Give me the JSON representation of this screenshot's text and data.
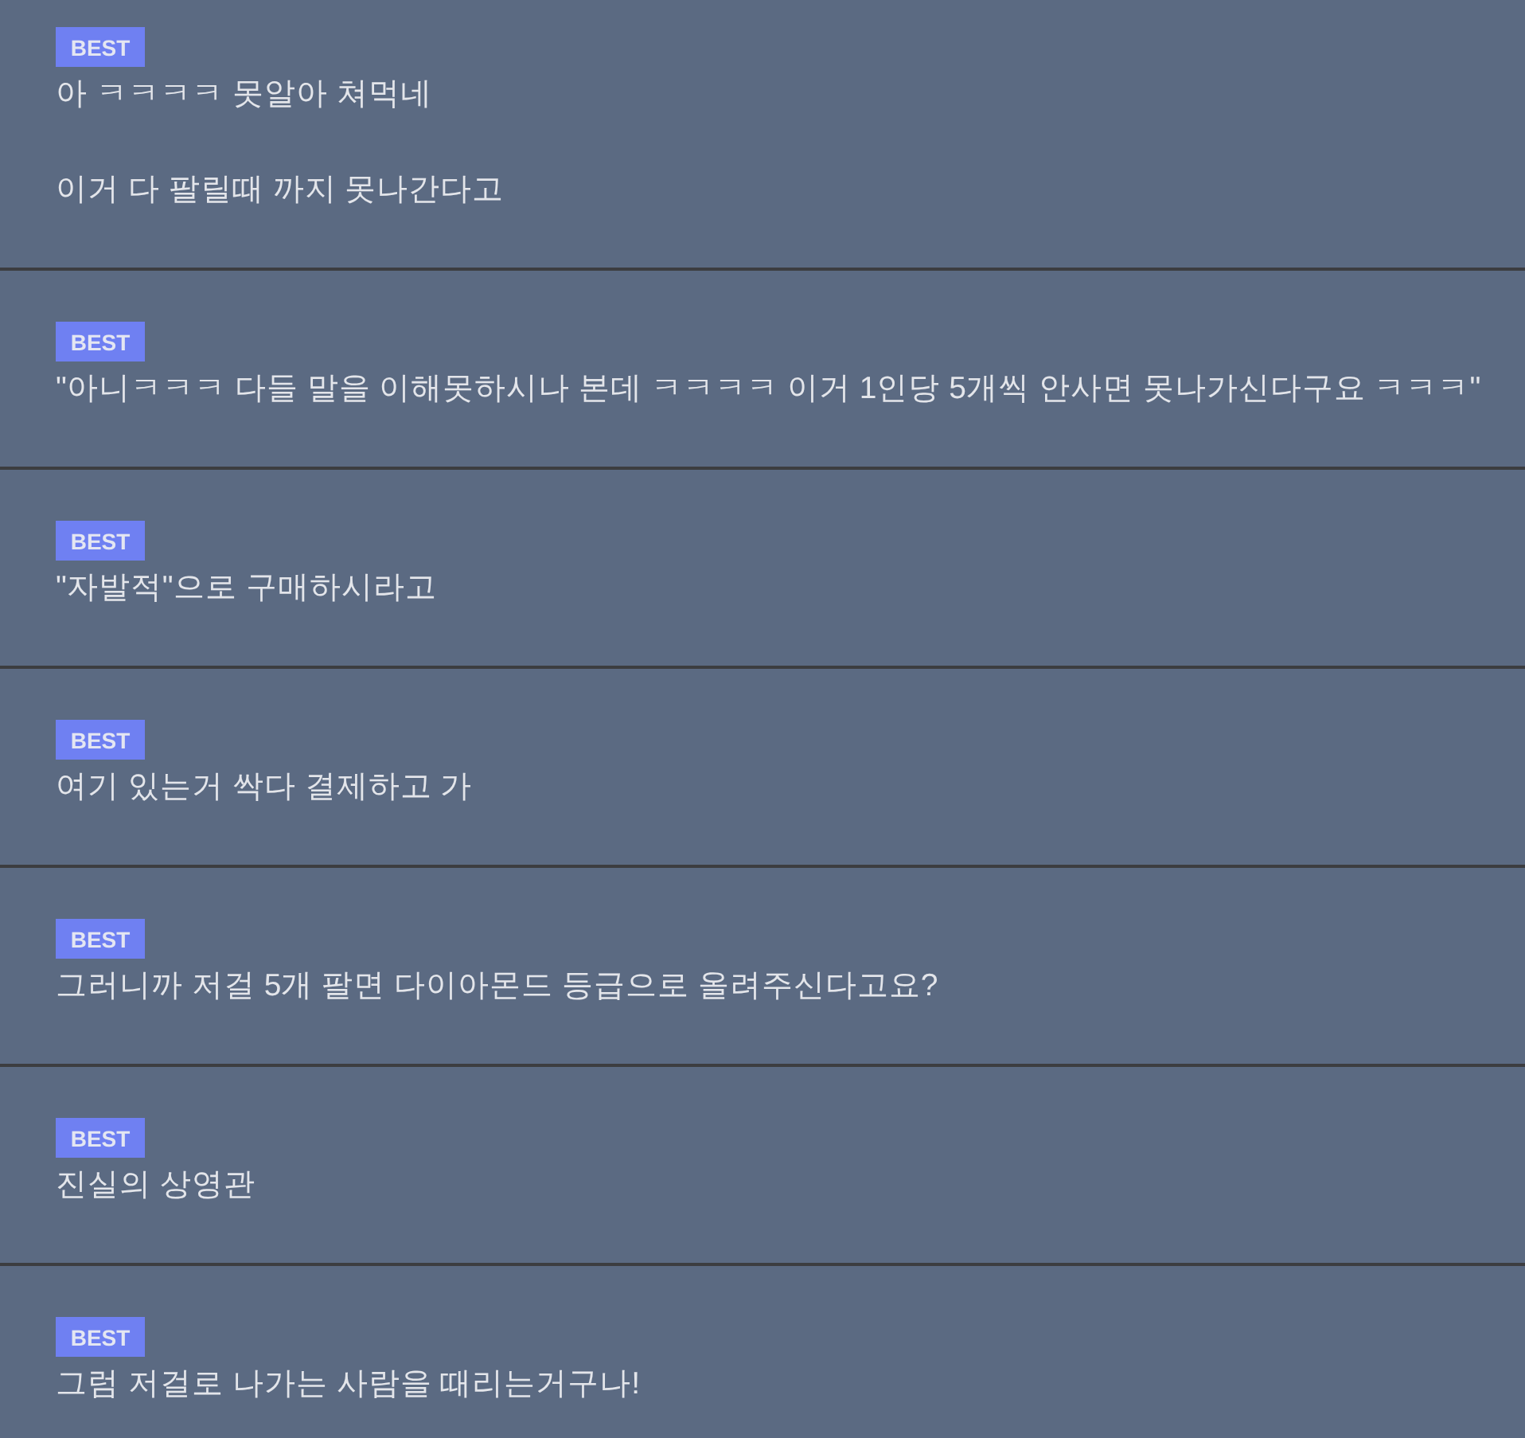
{
  "comments": [
    {
      "badge": "BEST",
      "text": "아 ㅋㅋㅋㅋ 못알아 쳐먹네\n\n이거 다 팔릴때 까지 못나간다고"
    },
    {
      "badge": "BEST",
      "text": "\"아니ㅋㅋㅋ 다들 말을 이해못하시나 본데 ㅋㅋㅋㅋ 이거 1인당 5개씩 안사면 못나가신다구요 ㅋㅋㅋ\""
    },
    {
      "badge": "BEST",
      "text": "\"자발적\"으로 구매하시라고"
    },
    {
      "badge": "BEST",
      "text": "여기 있는거 싹다 결제하고 가"
    },
    {
      "badge": "BEST",
      "text": "그러니까 저걸 5개 팔면 다이아몬드 등급으로 올려주신다고요?"
    },
    {
      "badge": "BEST",
      "text": "진실의 상영관"
    },
    {
      "badge": "BEST",
      "text": "그럼 저걸로 나가는 사람을 때리는거구나!"
    }
  ]
}
